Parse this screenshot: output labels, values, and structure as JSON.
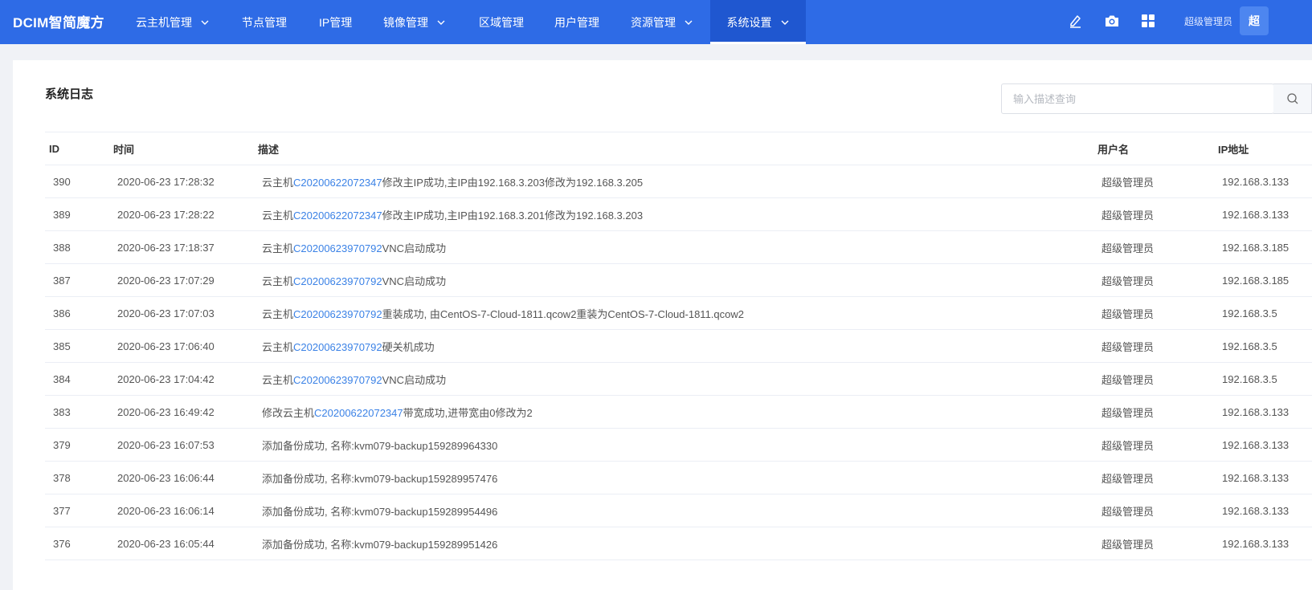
{
  "header": {
    "logo": "DCIM智简魔方",
    "nav": [
      {
        "label": "云主机管理",
        "dropdown": true
      },
      {
        "label": "节点管理",
        "dropdown": false
      },
      {
        "label": "IP管理",
        "dropdown": false
      },
      {
        "label": "镜像管理",
        "dropdown": true
      },
      {
        "label": "区域管理",
        "dropdown": false
      },
      {
        "label": "用户管理",
        "dropdown": false
      },
      {
        "label": "资源管理",
        "dropdown": true
      },
      {
        "label": "系统设置",
        "dropdown": true,
        "active": true
      }
    ],
    "icons": [
      "edit-icon",
      "camera-icon",
      "grid-icon"
    ],
    "user_name": "超级管理员",
    "avatar_text": "超",
    "brand_color": "#2e6be6"
  },
  "main": {
    "title": "系统日志",
    "search": {
      "placeholder": "输入描述查询",
      "value": ""
    },
    "table": {
      "columns": [
        "ID",
        "时间",
        "描述",
        "用户名",
        "IP地址"
      ],
      "rows": [
        {
          "id": "390",
          "time": "2020-06-23 17:28:32",
          "desc_pre": "云主机",
          "desc_link": "C20200622072347",
          "desc_post": "修改主IP成功,主IP由192.168.3.203修改为192.168.3.205",
          "user": "超级管理员",
          "ip": "192.168.3.133"
        },
        {
          "id": "389",
          "time": "2020-06-23 17:28:22",
          "desc_pre": "云主机",
          "desc_link": "C20200622072347",
          "desc_post": "修改主IP成功,主IP由192.168.3.201修改为192.168.3.203",
          "user": "超级管理员",
          "ip": "192.168.3.133"
        },
        {
          "id": "388",
          "time": "2020-06-23 17:18:37",
          "desc_pre": "云主机",
          "desc_link": "C20200623970792",
          "desc_post": "VNC启动成功",
          "user": "超级管理员",
          "ip": "192.168.3.185"
        },
        {
          "id": "387",
          "time": "2020-06-23 17:07:29",
          "desc_pre": "云主机",
          "desc_link": "C20200623970792",
          "desc_post": "VNC启动成功",
          "user": "超级管理员",
          "ip": "192.168.3.185"
        },
        {
          "id": "386",
          "time": "2020-06-23 17:07:03",
          "desc_pre": "云主机",
          "desc_link": "C20200623970792",
          "desc_post": "重装成功, 由CentOS-7-Cloud-1811.qcow2重装为CentOS-7-Cloud-1811.qcow2",
          "user": "超级管理员",
          "ip": "192.168.3.5"
        },
        {
          "id": "385",
          "time": "2020-06-23 17:06:40",
          "desc_pre": "云主机",
          "desc_link": "C20200623970792",
          "desc_post": "硬关机成功",
          "user": "超级管理员",
          "ip": "192.168.3.5"
        },
        {
          "id": "384",
          "time": "2020-06-23 17:04:42",
          "desc_pre": "云主机",
          "desc_link": "C20200623970792",
          "desc_post": "VNC启动成功",
          "user": "超级管理员",
          "ip": "192.168.3.5"
        },
        {
          "id": "383",
          "time": "2020-06-23 16:49:42",
          "desc_pre": "修改云主机",
          "desc_link": "C20200622072347",
          "desc_post": "带宽成功,进带宽由0修改为2",
          "user": "超级管理员",
          "ip": "192.168.3.133"
        },
        {
          "id": "379",
          "time": "2020-06-23 16:07:53",
          "desc_pre": "添加备份成功, 名称:kvm079-backup159289964330",
          "desc_link": "",
          "desc_post": "",
          "user": "超级管理员",
          "ip": "192.168.3.133"
        },
        {
          "id": "378",
          "time": "2020-06-23 16:06:44",
          "desc_pre": "添加备份成功, 名称:kvm079-backup159289957476",
          "desc_link": "",
          "desc_post": "",
          "user": "超级管理员",
          "ip": "192.168.3.133"
        },
        {
          "id": "377",
          "time": "2020-06-23 16:06:14",
          "desc_pre": "添加备份成功, 名称:kvm079-backup159289954496",
          "desc_link": "",
          "desc_post": "",
          "user": "超级管理员",
          "ip": "192.168.3.133"
        },
        {
          "id": "376",
          "time": "2020-06-23 16:05:44",
          "desc_pre": "添加备份成功, 名称:kvm079-backup159289951426",
          "desc_link": "",
          "desc_post": "",
          "user": "超级管理员",
          "ip": "192.168.3.133"
        }
      ]
    }
  }
}
